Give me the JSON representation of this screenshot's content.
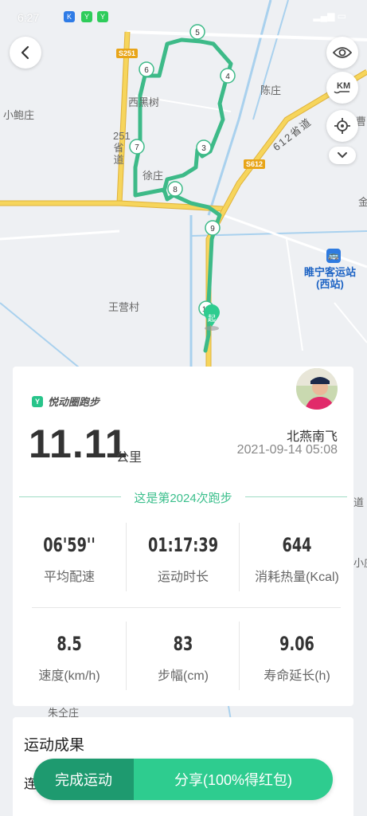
{
  "status_bar": {
    "time": "6:27"
  },
  "map": {
    "places": {
      "xiaopao": "小鲍庄",
      "xiheishu": "西黑树",
      "chenzhuang": "陈庄",
      "xuzhuang": "徐庄",
      "wangying": "王营村",
      "zhuquan": "朱仝庄"
    },
    "roads": {
      "s251": "S251",
      "s612": "S612",
      "road251_vertical": "251省道",
      "road612": "612省道"
    },
    "station": {
      "name": "睢宁客运站",
      "sub": "(西站)"
    },
    "markers": [
      "3",
      "4",
      "5",
      "6",
      "7",
      "8",
      "9",
      "10"
    ],
    "start_label": "起",
    "edge_labels": {
      "right1": "曹",
      "right2": "金",
      "right3": "道",
      "right4": "小庄"
    }
  },
  "colors": {
    "track": "#3dba88",
    "accent": "#2ecc8f",
    "accent_dark": "#1e9a6f",
    "road": "#f5cd4a"
  },
  "icons": {
    "back": "chevron-left-icon",
    "eye": "eye-icon",
    "km": "km-icon",
    "locate": "crosshair-icon",
    "more": "chevron-down-icon"
  },
  "summary": {
    "brand": "悦动圈跑步",
    "distance": "11.11",
    "unit": "公里",
    "username": "北燕南飞",
    "datetime": "2021-09-14 05:08",
    "run_count_text": "这是第2024次跑步"
  },
  "stats": [
    {
      "value": "06'59''",
      "label": "平均配速"
    },
    {
      "value": "01:17:39",
      "label": "运动时长"
    },
    {
      "value": "644",
      "label": "消耗热量(Kcal)"
    },
    {
      "value": "8.5",
      "label": "速度(km/h)"
    },
    {
      "value": "83",
      "label": "步幅(cm)"
    },
    {
      "value": "9.06",
      "label": "寿命延长(h)"
    }
  ],
  "results": {
    "title": "运动成果",
    "partial": "连"
  },
  "actions": {
    "finish": "完成运动",
    "share": "分享(100%得红包)"
  }
}
